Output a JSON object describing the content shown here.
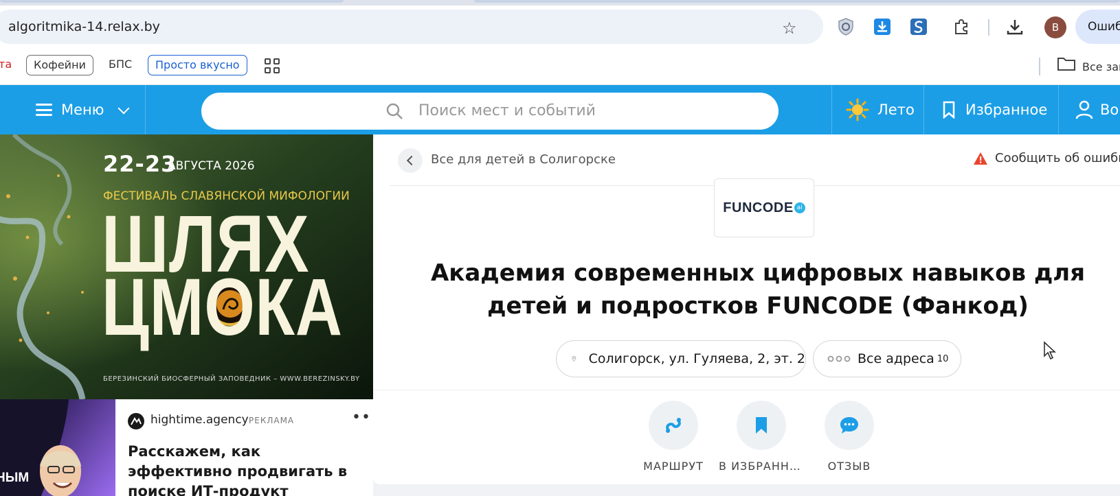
{
  "browser": {
    "url": "algoritmika-14.relax.by",
    "profile_initial": "B",
    "error_pill_label": "Ошиб",
    "bookmarks": [
      {
        "label": "та",
        "style": "red"
      },
      {
        "label": "Кофейни",
        "style": "outlined"
      },
      {
        "label": "БПС",
        "style": "plain"
      },
      {
        "label": "Просто вкусно",
        "style": "blue"
      }
    ],
    "all_bookmarks_label": "Все зак"
  },
  "header": {
    "menu_label": "Меню",
    "search_placeholder": "Поиск мест и событий",
    "summer_label": "Лето",
    "favorites_label": "Избранное",
    "login_label": "Во"
  },
  "banner": {
    "date": "22-23",
    "month": "АВГУСТА 2026",
    "subtitle": "ФЕСТИВАЛЬ СЛАВЯНСКОЙ МИФОЛОГИИ",
    "title_line1": "ШЛЯХ",
    "title_line2": "ЦМОКА",
    "footer": "БЕРЕЗИНСКИЙ БИОСФЕРНЫЙ ЗАПОВЕДНИК – WWW.BEREZINSKY.BY"
  },
  "ad": {
    "domain": "hightime.agency",
    "tag": "РЕКЛАМА",
    "more": "•••",
    "title": "Расскажем, как эффективно продвигать в поиске ИТ-продукт",
    "image_caption": "НЫМ"
  },
  "place": {
    "breadcrumb": "Все для детей в Солигорске",
    "report_label": "Сообщить об ошибке",
    "logo_text": "FUNCODE",
    "logo_badge": "ai",
    "title": "Академия современных цифровых навыков для детей и подростков FUNCODE (Фанкод)",
    "address": "Солигорск, ул. Гуляева, 2, эт. 2",
    "all_addresses_label": "Все адреса",
    "all_addresses_count": "10",
    "actions": [
      {
        "label": "МАРШРУТ",
        "icon": "route-icon"
      },
      {
        "label": "В ИЗБРАННОЕ",
        "icon": "bookmark-icon"
      },
      {
        "label": "ОТЗЫВ",
        "icon": "comment-icon"
      }
    ]
  },
  "colors": {
    "header_blue": "#1c9ee6",
    "accent_blue": "#1c9ee6",
    "warning": "#e8442c"
  }
}
